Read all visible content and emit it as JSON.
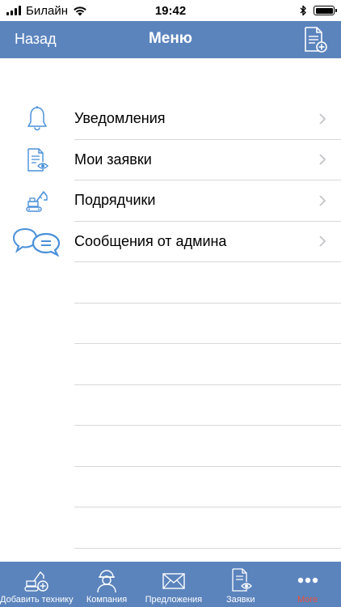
{
  "status_bar": {
    "carrier": "Билайн",
    "time": "19:42"
  },
  "nav": {
    "back_label": "Назад",
    "title": "Меню",
    "action_icon": "document-add-icon"
  },
  "menu": {
    "items": [
      {
        "label": "Уведомления",
        "icon": "bell-icon"
      },
      {
        "label": "Мои заявки",
        "icon": "document-eye-icon"
      },
      {
        "label": "Подрядчики",
        "icon": "excavator-icon"
      },
      {
        "label": "Сообщения от админа",
        "icon": "chat-bubbles-icon"
      }
    ]
  },
  "tab_bar": {
    "tabs": [
      {
        "label": "Добавить технику",
        "icon": "excavator-add-icon"
      },
      {
        "label": "Компания",
        "icon": "worker-icon"
      },
      {
        "label": "Предложения",
        "icon": "envelope-icon"
      },
      {
        "label": "Заявки",
        "icon": "document-eye-icon"
      },
      {
        "label": "More",
        "icon": "more-dots-icon",
        "active": true
      }
    ]
  },
  "colors": {
    "brand": "#5b84bd",
    "icon_blue": "#4a90d9",
    "active_tab": "#e8503a"
  }
}
